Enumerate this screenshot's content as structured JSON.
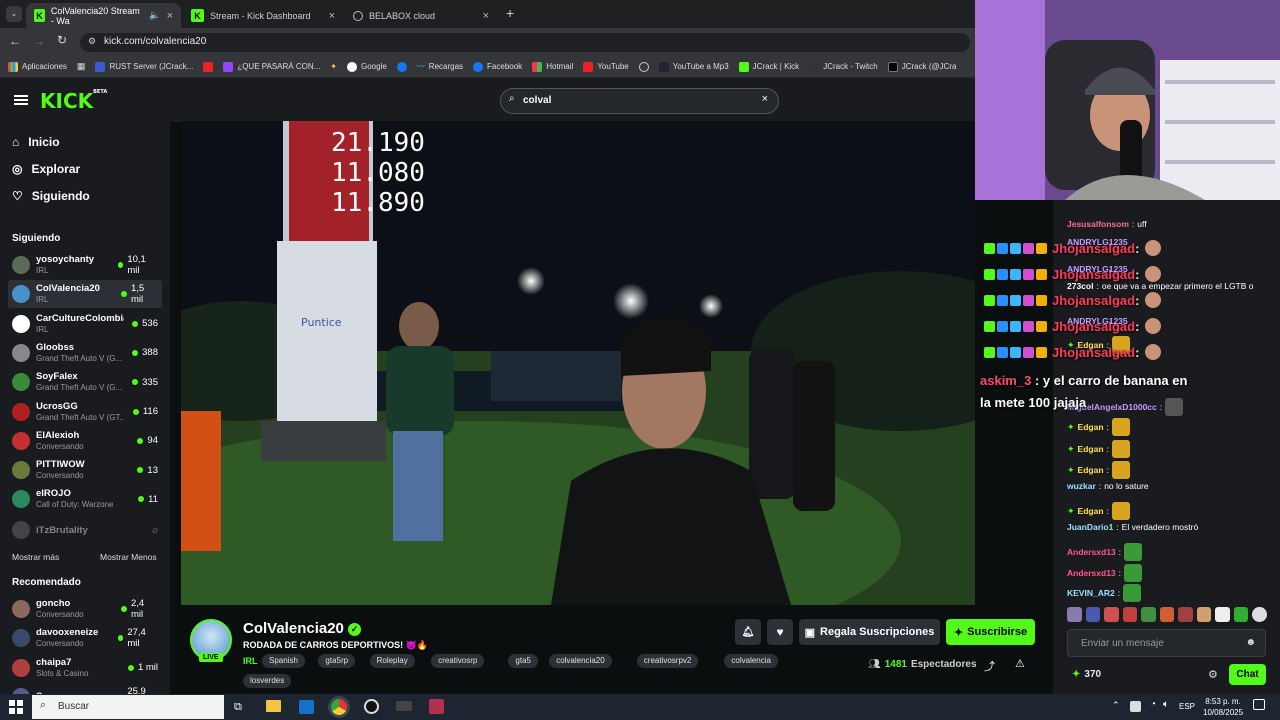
{
  "browser": {
    "tabs": [
      {
        "label": "ColValencia20 Stream - Wa"
      },
      {
        "label": "Stream - Kick Dashboard"
      },
      {
        "label": "BELABOX cloud"
      }
    ],
    "url": "kick.com/colvalencia20",
    "bookmarks": [
      "Aplicaciones",
      "RUST Server (JCrack...",
      "¿QUE PASARÁ CON...",
      "Google",
      "Recargas",
      "Facebook",
      "Hotmail",
      "YouTube",
      "YouTube a Mp3",
      "JCrack | Kick",
      "JCrack - Twitch",
      "JCrack (@JCra"
    ]
  },
  "header": {
    "logo": "KICK",
    "logo_beta": "BETA",
    "search_value": "colval"
  },
  "sidebar": {
    "nav": [
      {
        "label": "Inicio"
      },
      {
        "label": "Explorar"
      },
      {
        "label": "Siguiendo"
      }
    ],
    "following_title": "Siguiendo",
    "following": [
      {
        "name": "yosoychanty",
        "cat": "IRL",
        "count": "10,1 mil",
        "color": "#5b6b5a"
      },
      {
        "name": "ColValencia20",
        "cat": "IRL",
        "count": "1,5 mil",
        "color": "#4a90c9"
      },
      {
        "name": "CarCultureColombia",
        "cat": "IRL",
        "count": "536",
        "color": "#ffffff"
      },
      {
        "name": "Gloobss",
        "cat": "Grand Theft Auto V (G...",
        "count": "388",
        "color": "#888888"
      },
      {
        "name": "SoyFalex",
        "cat": "Grand Theft Auto V (G...",
        "count": "335",
        "color": "#3a8a3a"
      },
      {
        "name": "UcrosGG",
        "cat": "Grand Theft Auto V (GT...",
        "count": "116",
        "color": "#b02020"
      },
      {
        "name": "ElAlexioh",
        "cat": "Conversando",
        "count": "94",
        "color": "#c43030"
      },
      {
        "name": "PITTIWOW",
        "cat": "Conversando",
        "count": "13",
        "color": "#6a7a3a"
      },
      {
        "name": "elROJO",
        "cat": "Call of Duty: Warzone",
        "count": "11",
        "color": "#2c8a5a"
      }
    ],
    "offline": {
      "name": "iTzBrutality"
    },
    "show_more": "Mostrar más",
    "show_less": "Mostrar Menos",
    "recommended_title": "Recomendado",
    "recommended": [
      {
        "name": "goncho",
        "cat": "Conversando",
        "count": "2,4 mil",
        "color": "#8a6a5a"
      },
      {
        "name": "davooxeneize",
        "cat": "Conversando",
        "count": "27,4 mil",
        "color": "#3a4a6a"
      },
      {
        "name": "chaipa7",
        "cat": "Slots & Casino",
        "count": "1 mil",
        "color": "#b04040"
      },
      {
        "name": "Spreen",
        "cat": "",
        "count": "25,9 mil",
        "color": "#5a5a8a"
      }
    ]
  },
  "stream": {
    "channel": "ColValencia20",
    "live": "LIVE",
    "title": "RODADA DE CARROS DEPORTIVOS! 😈🔥",
    "category": "IRL",
    "tags": [
      "Spanish",
      "gta5rp",
      "Roleplay",
      "creativosrp",
      "gta5",
      "colvalencia20",
      "creativosrpv2",
      "colvalencia",
      "losverdes"
    ],
    "viewers": "1481",
    "viewers_label": "Espectadores",
    "gift_label": "Regala Suscripciones",
    "subscribe_label": "Suscribirse",
    "sign_prices": [
      "21.190",
      "11.080",
      "11.890"
    ],
    "sign_brand": "Puntice"
  },
  "chat": {
    "messages": [
      {
        "user": "Jesusalfonsom",
        "color": "#ff6a9a",
        "text": "uff"
      },
      {
        "user": "273col",
        "color": "#ffffff",
        "text": "oe que va a empezar primero el LGTB o"
      },
      {
        "user": "Edgan",
        "color": "#ffe14a",
        "text": ""
      },
      {
        "user": "MiguelAngelxD1000cc",
        "color": "#c59bff",
        "text": ""
      },
      {
        "user": "Edgan",
        "color": "#ffe14a",
        "text": ""
      },
      {
        "user": "Edgan",
        "color": "#ffe14a",
        "text": ""
      },
      {
        "user": "Edgan",
        "color": "#ffe14a",
        "text": ""
      },
      {
        "user": "wuzkar",
        "color": "#9ee0ff",
        "text": "no lo sature"
      },
      {
        "user": "Edgan",
        "color": "#ffe14a",
        "text": ""
      },
      {
        "user": "JuanDario1",
        "color": "#9ee0ff",
        "text": "El verdadero mostró"
      },
      {
        "user": "Andersxd13",
        "color": "#ff5a8a",
        "text": ""
      },
      {
        "user": "Andersxd13",
        "color": "#ff5a8a",
        "text": ""
      },
      {
        "user": "KEVIN_AR2",
        "color": "#9ee0ff",
        "text": ""
      }
    ],
    "overlay_user": "Jhojansalgad",
    "overlay_user2": "ANDRYLG1235",
    "overlay_msg_user": "askim_3",
    "overlay_msg": "y el carro de banana en",
    "overlay_msg2": "la mete 100 jajaja",
    "input_placeholder": "Enviar un mensaje",
    "points": "370",
    "chat_button": "Chat"
  },
  "taskbar": {
    "search": "Buscar",
    "lang": "ESP",
    "time": "8:53 p. m.",
    "date": "10/08/2025"
  }
}
